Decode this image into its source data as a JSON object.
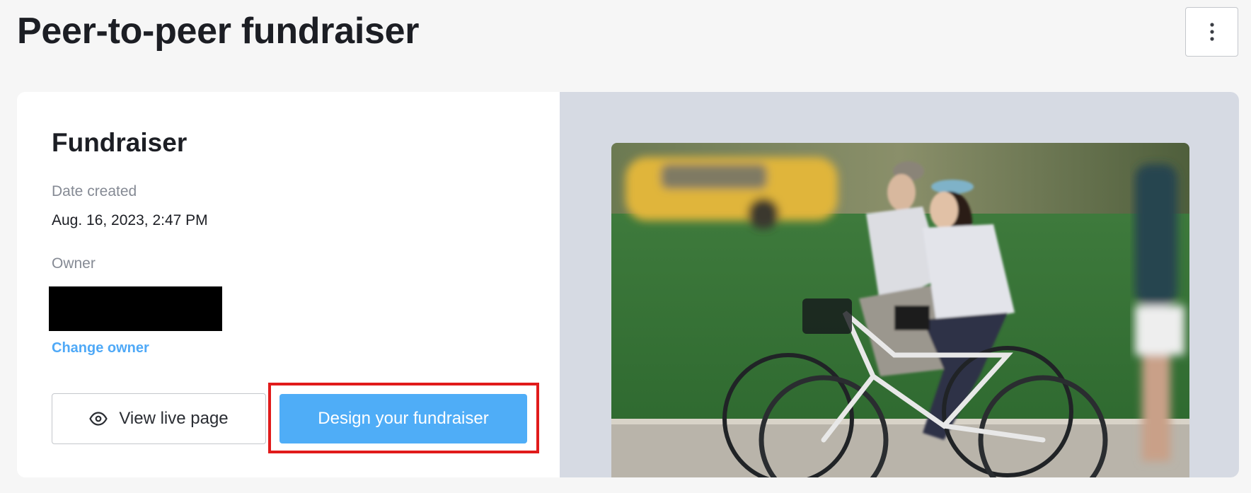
{
  "header": {
    "title": "Peer-to-peer fundraiser",
    "more_icon": "vertical-ellipsis-icon"
  },
  "fundraiser": {
    "title": "Fundraiser",
    "date_created_label": "Date created",
    "date_created_value": "Aug. 16, 2023, 2:47 PM",
    "owner_label": "Owner",
    "owner_value_redacted": true,
    "change_owner_label": "Change owner",
    "view_live_label": "View live page",
    "view_live_icon": "eye-icon",
    "design_label": "Design your fundraiser",
    "highlighted_action": "Design your fundraiser"
  },
  "hero": {
    "image_subject": "two people riding bicycles past a yellow taxi"
  },
  "colors": {
    "accent": "#4fadf7",
    "link": "#4fa9f7",
    "highlight": "#e11b1b",
    "panel": "#d6dae3",
    "page_background": "#f6f6f6"
  }
}
